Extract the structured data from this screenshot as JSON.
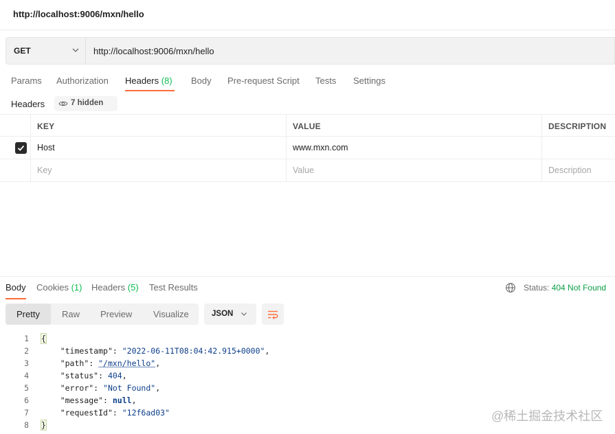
{
  "title_bar": {
    "title": "http://localhost:9006/mxn/hello"
  },
  "request": {
    "method": "GET",
    "url": "http://localhost:9006/mxn/hello"
  },
  "request_tabs": [
    {
      "label": "Params"
    },
    {
      "label": "Authorization"
    },
    {
      "label": "Headers",
      "count": "(8)",
      "active": true
    },
    {
      "label": "Body"
    },
    {
      "label": "Pre-request Script"
    },
    {
      "label": "Tests"
    },
    {
      "label": "Settings"
    }
  ],
  "headers_section": {
    "label": "Headers",
    "hidden_text": "7 hidden"
  },
  "table": {
    "columns": [
      "KEY",
      "VALUE",
      "DESCRIPTION"
    ],
    "rows": [
      {
        "checked": true,
        "key": "Host",
        "value": "www.mxn.com",
        "description": ""
      }
    ],
    "placeholders": {
      "key": "Key",
      "value": "Value",
      "description": "Description"
    }
  },
  "response_tabs": [
    {
      "label": "Body",
      "active": true
    },
    {
      "label": "Cookies",
      "count": "(1)"
    },
    {
      "label": "Headers",
      "count": "(5)"
    },
    {
      "label": "Test Results"
    }
  ],
  "status": {
    "label": "Status:",
    "value": "404 Not Found"
  },
  "view_tabs": [
    {
      "label": "Pretty",
      "active": true
    },
    {
      "label": "Raw"
    },
    {
      "label": "Preview"
    },
    {
      "label": "Visualize"
    }
  ],
  "format": "JSON",
  "code": {
    "line_numbers": [
      "1",
      "2",
      "3",
      "4",
      "5",
      "6",
      "7",
      "8"
    ],
    "open_brace": "{",
    "close_brace": "}",
    "entries": [
      {
        "key": "\"timestamp\"",
        "value": "\"2022-06-11T08:04:42.915+0000\"",
        "comma": ","
      },
      {
        "key": "\"path\"",
        "value": "\"/mxn/hello\"",
        "comma": ","
      },
      {
        "key": "\"status\"",
        "value": "404",
        "comma": ","
      },
      {
        "key": "\"error\"",
        "value": "\"Not Found\"",
        "comma": ","
      },
      {
        "key": "\"message\"",
        "value": "null",
        "comma": ","
      },
      {
        "key": "\"requestId\"",
        "value": "\"12f6ad03\"",
        "comma": ""
      }
    ]
  },
  "watermark": "@稀土掘金技术社区",
  "colors": {
    "accent": "#ff6c37",
    "count_green": "#0cbb52",
    "status_green": "#0c9e46",
    "json_value": "#0c3e8a"
  }
}
